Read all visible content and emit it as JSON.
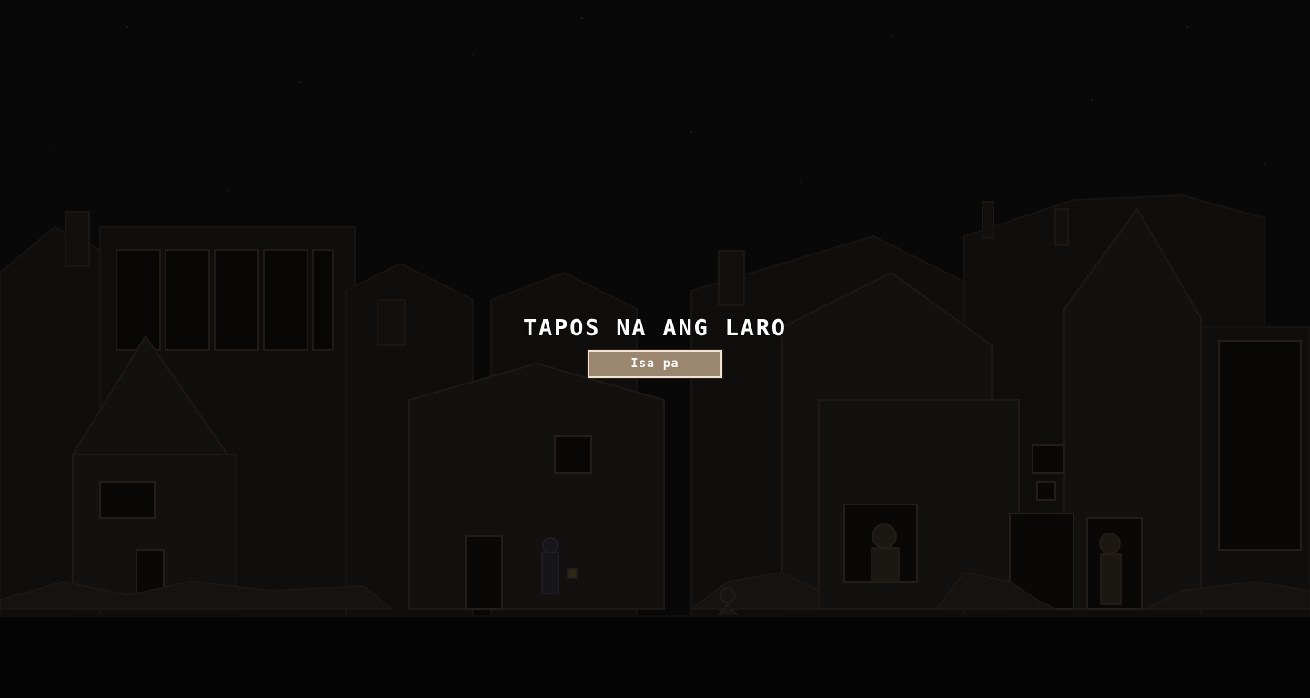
{
  "game": {
    "screen": "game-over",
    "title": "TAPOS NA ANG LARO",
    "retry_label": "Isa pa"
  },
  "colors": {
    "sky": "#0b0a0a",
    "ground": "#060505",
    "button_fill": "#9b8670",
    "button_border": "#f2e4d2",
    "text": "#ffffff"
  },
  "scene": {
    "setting": "ruined town at night",
    "characters": [
      "man-holding-mug",
      "bearded-man-in-window",
      "person-at-doorway",
      "injured-person-on-ground"
    ]
  }
}
